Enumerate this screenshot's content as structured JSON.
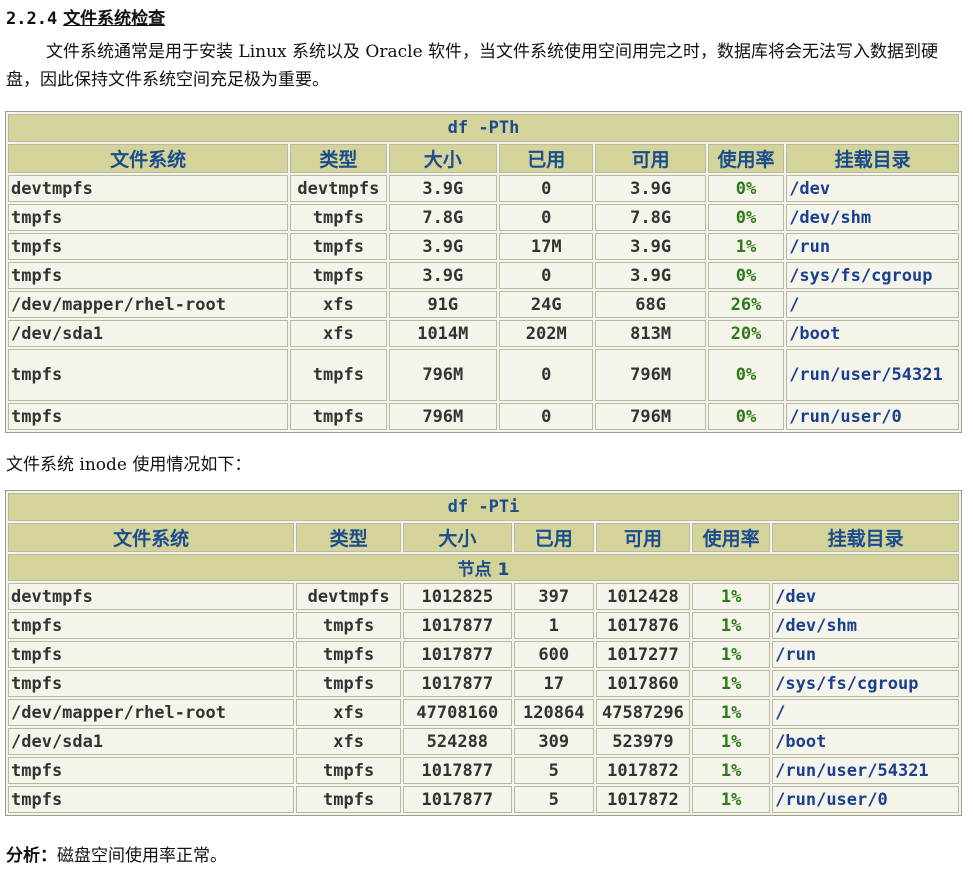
{
  "section": {
    "number": "2.2.4",
    "title": "文件系统检查"
  },
  "intro": "文件系统通常是用于安装 Linux 系统以及 Oracle 软件，当文件系统使用空间用完之时，数据库将会无法写入数据到硬盘，因此保持文件系统空间充足极为重要。",
  "headers": [
    "文件系统",
    "类型",
    "大小",
    "已用",
    "可用",
    "使用率",
    "挂载目录"
  ],
  "df_pth": {
    "caption": "df -PTh",
    "rows": [
      [
        "devtmpfs",
        "devtmpfs",
        "3.9G",
        "0",
        "3.9G",
        "0%",
        "/dev"
      ],
      [
        "tmpfs",
        "tmpfs",
        "7.8G",
        "0",
        "7.8G",
        "0%",
        "/dev/shm"
      ],
      [
        "tmpfs",
        "tmpfs",
        "3.9G",
        "17M",
        "3.9G",
        "1%",
        "/run"
      ],
      [
        "tmpfs",
        "tmpfs",
        "3.9G",
        "0",
        "3.9G",
        "0%",
        "/sys/fs/cgroup"
      ],
      [
        "/dev/mapper/rhel-root",
        "xfs",
        "91G",
        "24G",
        "68G",
        "26%",
        "/"
      ],
      [
        "/dev/sda1",
        "xfs",
        "1014M",
        "202M",
        "813M",
        "20%",
        "/boot"
      ],
      [
        "tmpfs",
        "tmpfs",
        "796M",
        "0",
        "796M",
        "0%",
        "/run/user/54321"
      ],
      [
        "tmpfs",
        "tmpfs",
        "796M",
        "0",
        "796M",
        "0%",
        "/run/user/0"
      ]
    ]
  },
  "inode_note": "文件系统 inode 使用情况如下：",
  "df_pti": {
    "caption": "df -PTi",
    "node_label": "节点 1",
    "rows": [
      [
        "devtmpfs",
        "devtmpfs",
        "1012825",
        "397",
        "1012428",
        "1%",
        "/dev"
      ],
      [
        "tmpfs",
        "tmpfs",
        "1017877",
        "1",
        "1017876",
        "1%",
        "/dev/shm"
      ],
      [
        "tmpfs",
        "tmpfs",
        "1017877",
        "600",
        "1017277",
        "1%",
        "/run"
      ],
      [
        "tmpfs",
        "tmpfs",
        "1017877",
        "17",
        "1017860",
        "1%",
        "/sys/fs/cgroup"
      ],
      [
        "/dev/mapper/rhel-root",
        "xfs",
        "47708160",
        "120864",
        "47587296",
        "1%",
        "/"
      ],
      [
        "/dev/sda1",
        "xfs",
        "524288",
        "309",
        "523979",
        "1%",
        "/boot"
      ],
      [
        "tmpfs",
        "tmpfs",
        "1017877",
        "5",
        "1017872",
        "1%",
        "/run/user/54321"
      ],
      [
        "tmpfs",
        "tmpfs",
        "1017877",
        "5",
        "1017872",
        "1%",
        "/run/user/0"
      ]
    ]
  },
  "analysis": {
    "label": "分析：",
    "text": "磁盘空间使用率正常。"
  }
}
